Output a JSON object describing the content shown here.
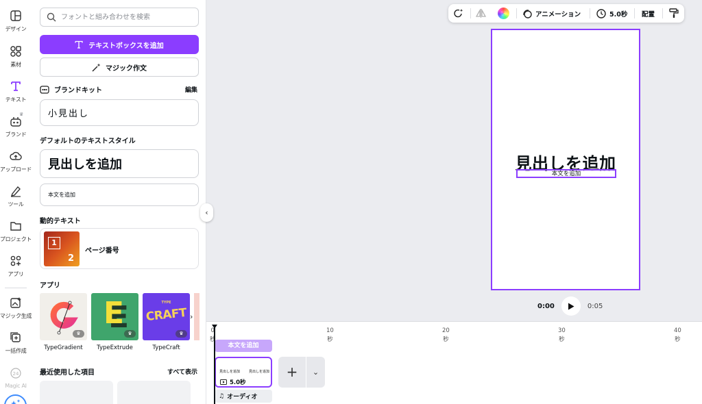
{
  "sidebar": {
    "items": [
      {
        "label": "デザイン",
        "icon": "layout-icon"
      },
      {
        "label": "素材",
        "icon": "shapes-icon"
      },
      {
        "label": "テキスト",
        "icon": "text-icon",
        "active": true
      },
      {
        "label": "ブランド",
        "icon": "brand-icon"
      },
      {
        "label": "アップロード",
        "icon": "upload-cloud-icon"
      },
      {
        "label": "ツール",
        "icon": "pen-tool-icon"
      },
      {
        "label": "プロジェクト",
        "icon": "folder-icon"
      },
      {
        "label": "アプリ",
        "icon": "apps-icon"
      },
      {
        "label": "マジック生成",
        "icon": "magic-image-icon"
      },
      {
        "label": "一括作成",
        "icon": "bulk-create-icon"
      }
    ],
    "partial_label": "Magic AI"
  },
  "panel": {
    "search_placeholder": "フォントと組み合わせを検索",
    "add_textbox_label": "テキストボックスを追加",
    "magic_write_label": "マジック作文",
    "brand_kit": {
      "title": "ブランドキット",
      "edit_label": "編集",
      "subheading": "小見出し"
    },
    "default_styles": {
      "title": "デフォルトのテキストスタイル",
      "heading": "見出しを追加",
      "body": "本文を追加"
    },
    "dynamic_text": {
      "title": "動的テキスト",
      "page_number_label": "ページ番号",
      "thumb_one": "1",
      "thumb_two": "2"
    },
    "apps": {
      "title": "アプリ",
      "items": [
        {
          "name": "TypeGradient"
        },
        {
          "name": "TypeExtrude",
          "letter": "E"
        },
        {
          "name": "TypeCraft",
          "badge": "TYPE",
          "word": "CRAFT"
        }
      ]
    },
    "recent": {
      "title": "最近使用した項目",
      "see_all": "すべて表示"
    }
  },
  "toolbar": {
    "animation_label": "アニメーション",
    "duration_label": "5.0秒",
    "position_label": "配置"
  },
  "canvas": {
    "heading": "見出しを追加",
    "body": "本文を追加"
  },
  "playback": {
    "current": "0:00",
    "total": "0:05"
  },
  "timeline": {
    "ticks": [
      {
        "num": "0",
        "unit": "秒"
      },
      {
        "num": "10",
        "unit": "秒"
      },
      {
        "num": "20",
        "unit": "秒"
      },
      {
        "num": "30",
        "unit": "秒"
      },
      {
        "num": "40",
        "unit": "秒"
      }
    ],
    "text_track_label": "本文を追加",
    "clip": {
      "mini_heading_1": "見出しを追加",
      "mini_heading_2": "見出しを追加",
      "duration": "5.0秒"
    },
    "add_symbol": "+",
    "audio_label": "オーディオ"
  }
}
